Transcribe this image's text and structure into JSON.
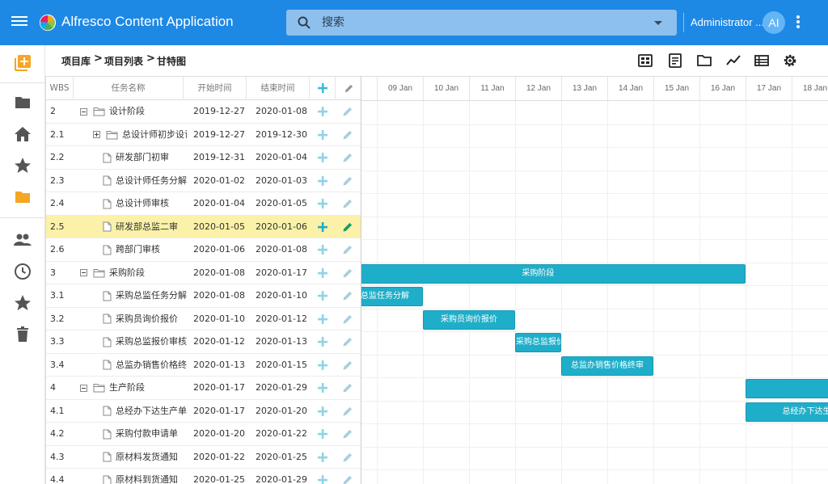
{
  "app": {
    "title": "Alfresco Content Application",
    "search_placeholder": "搜索",
    "user_name": "Administrator ...",
    "user_initials": "AI"
  },
  "colors": {
    "header": "#1e88e5",
    "bar": "#1faec9",
    "selected_row": "#fbf1a8",
    "nav_accent": "#f5a623"
  },
  "sidenav": [
    "create-icon",
    "folder-icon",
    "home-icon",
    "star-icon",
    "folder-open-icon",
    "people-icon",
    "clock-icon",
    "favorite-icon",
    "trash-icon"
  ],
  "breadcrumb": {
    "items": [
      "项目库",
      "项目列表",
      "甘特图"
    ],
    "separator": ">"
  },
  "toolbar": [
    "view-details-icon",
    "document-icon",
    "folder-icon",
    "trend-chart-icon",
    "list-icon",
    "settings-icon"
  ],
  "grid": {
    "headers": {
      "wbs": "WBS",
      "name": "任务名称",
      "start": "开始时间",
      "end": "结束时间"
    },
    "rows": [
      {
        "wbs": "2",
        "name": "设计阶段",
        "start": "2019-12-27",
        "end": "2020-01-08",
        "type": "group-open",
        "level": 0
      },
      {
        "wbs": "2.1",
        "name": "总设计师初步设计",
        "start": "2019-12-27",
        "end": "2019-12-30",
        "type": "group-closed",
        "level": 1
      },
      {
        "wbs": "2.2",
        "name": "研发部门初审",
        "start": "2019-12-31",
        "end": "2020-01-04",
        "type": "task",
        "level": 1
      },
      {
        "wbs": "2.3",
        "name": "总设计师任务分解",
        "start": "2020-01-02",
        "end": "2020-01-03",
        "type": "task",
        "level": 1
      },
      {
        "wbs": "2.4",
        "name": "总设计师审核",
        "start": "2020-01-04",
        "end": "2020-01-05",
        "type": "task",
        "level": 1
      },
      {
        "wbs": "2.5",
        "name": "研发部总监二审",
        "start": "2020-01-05",
        "end": "2020-01-06",
        "type": "task",
        "level": 1,
        "selected": true
      },
      {
        "wbs": "2.6",
        "name": "跨部门审核",
        "start": "2020-01-06",
        "end": "2020-01-08",
        "type": "task",
        "level": 1
      },
      {
        "wbs": "3",
        "name": "采购阶段",
        "start": "2020-01-08",
        "end": "2020-01-17",
        "type": "group-open",
        "level": 0
      },
      {
        "wbs": "3.1",
        "name": "采购总监任务分解",
        "start": "2020-01-08",
        "end": "2020-01-10",
        "type": "task",
        "level": 1
      },
      {
        "wbs": "3.2",
        "name": "采购员询价报价",
        "start": "2020-01-10",
        "end": "2020-01-12",
        "type": "task",
        "level": 1
      },
      {
        "wbs": "3.3",
        "name": "采购总监报价审核",
        "start": "2020-01-12",
        "end": "2020-01-13",
        "type": "task",
        "level": 1
      },
      {
        "wbs": "3.4",
        "name": "总监办销售价格终审",
        "start": "2020-01-13",
        "end": "2020-01-15",
        "type": "task",
        "level": 1
      },
      {
        "wbs": "4",
        "name": "生产阶段",
        "start": "2020-01-17",
        "end": "2020-01-29",
        "type": "group-open",
        "level": 0
      },
      {
        "wbs": "4.1",
        "name": "总经办下达生产单",
        "start": "2020-01-17",
        "end": "2020-01-20",
        "type": "task",
        "level": 1
      },
      {
        "wbs": "4.2",
        "name": "采购付款申请单",
        "start": "2020-01-20",
        "end": "2020-01-22",
        "type": "task",
        "level": 1
      },
      {
        "wbs": "4.3",
        "name": "原材料发货通知",
        "start": "2020-01-22",
        "end": "2020-01-25",
        "type": "task",
        "level": 1
      },
      {
        "wbs": "4.4",
        "name": "原材料到货通知",
        "start": "2020-01-25",
        "end": "2020-01-29",
        "type": "task",
        "level": 1
      }
    ]
  },
  "gantt": {
    "days": [
      "09 Jan",
      "10 Jan",
      "11 Jan",
      "12 Jan",
      "13 Jan",
      "14 Jan",
      "15 Jan",
      "16 Jan",
      "17 Jan",
      "18 Jan"
    ],
    "bars": [
      {
        "row": 7,
        "label": "采购阶段",
        "start": "2020-01-08",
        "end": "2020-01-17"
      },
      {
        "row": 8,
        "label": "采购总监任务分解",
        "start": "2020-01-08",
        "end": "2020-01-10"
      },
      {
        "row": 9,
        "label": "采购员询价报价",
        "start": "2020-01-10",
        "end": "2020-01-12"
      },
      {
        "row": 10,
        "label": "采购总监报价审核",
        "start": "2020-01-12",
        "end": "2020-01-13"
      },
      {
        "row": 11,
        "label": "总监办销售价格终审",
        "start": "2020-01-13",
        "end": "2020-01-15"
      },
      {
        "row": 12,
        "label": "",
        "start": "2020-01-17",
        "end": "2020-01-29"
      },
      {
        "row": 13,
        "label": "总经办下达生产单",
        "start": "2020-01-17",
        "end": "2020-01-20"
      }
    ]
  }
}
